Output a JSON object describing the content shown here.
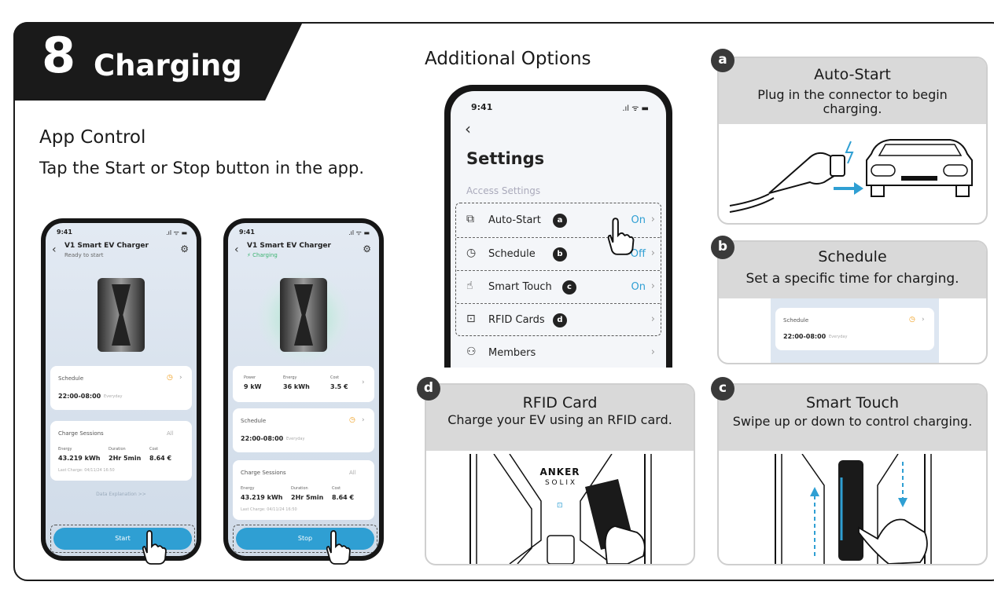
{
  "header": {
    "step_number": "8",
    "title": "Charging"
  },
  "app_control": {
    "heading": "App Control",
    "instruction": "Tap the Start or Stop button in the app."
  },
  "phone_common": {
    "time": "9:41",
    "signal_icons": ".ıl ᯤ ▬",
    "device_name": "V1 Smart EV Charger",
    "schedule_label": "Schedule",
    "schedule_time": "22:00-08:00",
    "schedule_days": "Everyday",
    "sessions_label": "Charge Sessions",
    "sessions_all": "All",
    "energy_label": "Energy",
    "energy_value": "43.219 kWh",
    "duration_label": "Duration",
    "duration_value": "2Hr 5min",
    "cost_label": "Cost",
    "cost_value": "8.64 €",
    "last_charge": "Last Charge: 04/11/24 16:50"
  },
  "phone_left": {
    "status": "Ready to start",
    "data_explanation": "Data Explanation >>",
    "button_label": "Start"
  },
  "phone_right": {
    "status": "⚡ Charging",
    "power_label": "Power",
    "power_value": "9 kW",
    "energy_label": "Energy",
    "energy_value": "36 kWh",
    "cost_label": "Cost",
    "cost_value": "3.5 €",
    "button_label": "Stop"
  },
  "additional": {
    "heading": "Additional Options",
    "settings": {
      "time": "9:41",
      "title": "Settings",
      "section": "Access Settings",
      "rows": [
        {
          "label": "Auto-Start",
          "badge": "a",
          "status": "On"
        },
        {
          "label": "Schedule",
          "badge": "b",
          "status": "Off"
        },
        {
          "label": "Smart Touch",
          "badge": "c",
          "status": "On"
        },
        {
          "label": "RFID Cards",
          "badge": "d",
          "status": ""
        },
        {
          "label": "Members",
          "badge": "",
          "status": ""
        }
      ]
    }
  },
  "cards": {
    "a": {
      "letter": "a",
      "title": "Auto-Start",
      "desc": "Plug in the connector to begin charging."
    },
    "b": {
      "letter": "b",
      "title": "Schedule",
      "desc": "Set a specific time for charging.",
      "inner_label": "Schedule",
      "inner_time": "22:00-08:00",
      "inner_days": "Everyday"
    },
    "c": {
      "letter": "c",
      "title": "Smart Touch",
      "desc": "Swipe up or down to control charging."
    },
    "d": {
      "letter": "d",
      "title": "RFID Card",
      "desc": "Charge your EV using an RFID card.",
      "brand_top": "ANKER",
      "brand_bottom": "S O L I X"
    }
  },
  "colors": {
    "accent_blue": "#2f9fd3",
    "dark": "#1a1a1a",
    "header_gray": "#d9d9d9",
    "clock_orange": "#f0a020"
  }
}
